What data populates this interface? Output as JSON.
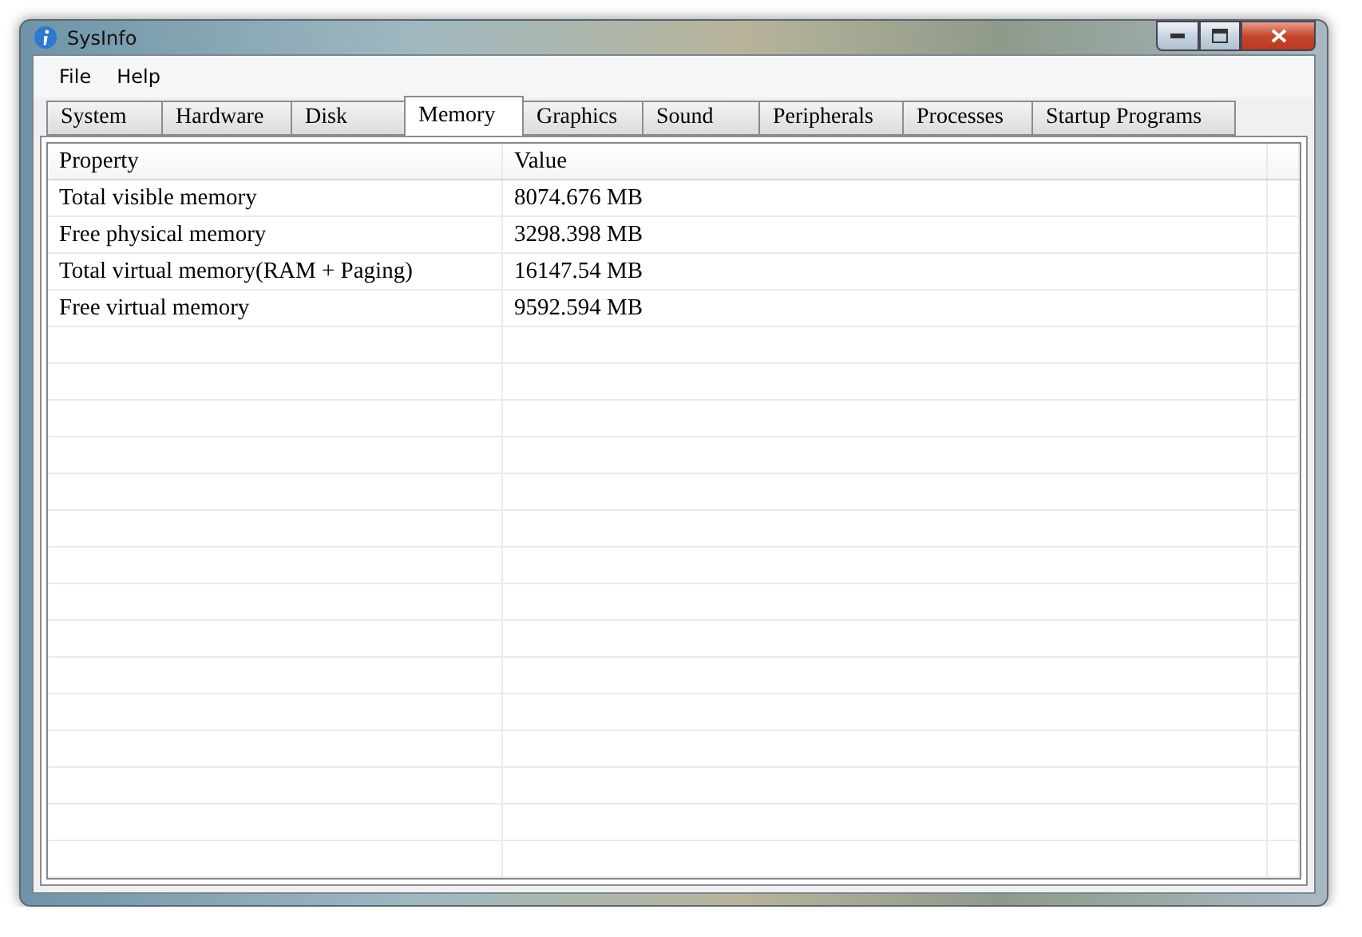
{
  "window": {
    "title": "SysInfo"
  },
  "menu": [
    "File",
    "Help"
  ],
  "tabs": [
    {
      "label": "System",
      "selected": false
    },
    {
      "label": "Hardware",
      "selected": false
    },
    {
      "label": "Disk",
      "selected": false
    },
    {
      "label": "Memory",
      "selected": true
    },
    {
      "label": "Graphics",
      "selected": false
    },
    {
      "label": "Sound",
      "selected": false
    },
    {
      "label": "Peripherals",
      "selected": false
    },
    {
      "label": "Processes",
      "selected": false
    },
    {
      "label": "Startup Programs",
      "selected": false
    }
  ],
  "table": {
    "columns": [
      "Property",
      "Value"
    ],
    "rows": [
      [
        "Total visible memory",
        "8074.676 MB"
      ],
      [
        "Free physical memory",
        "3298.398 MB"
      ],
      [
        "Total virtual memory(RAM + Paging)",
        "16147.54 MB"
      ],
      [
        "Free virtual memory",
        "9592.594 MB"
      ]
    ]
  }
}
